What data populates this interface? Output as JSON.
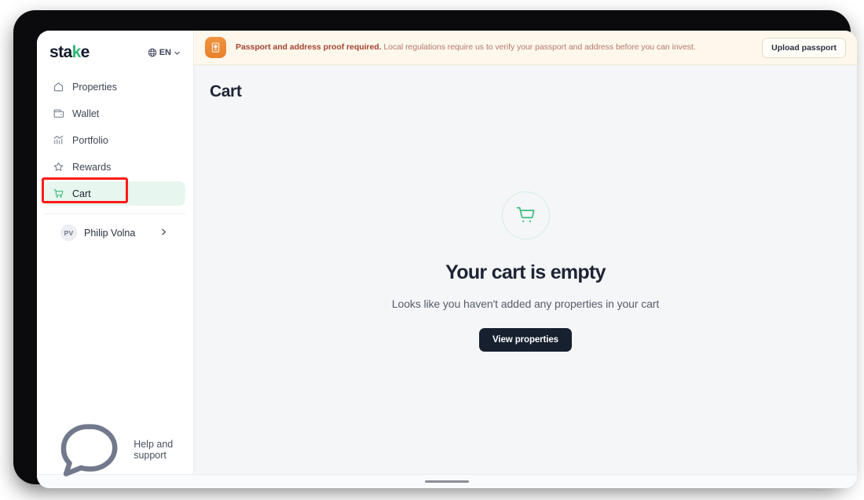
{
  "brand": {
    "logo_main": "sta",
    "logo_accent": "k",
    "logo_tail": "e",
    "accent_color": "#2fb875"
  },
  "sidebar": {
    "language": {
      "label": "EN",
      "icon": "globe-icon",
      "chevron": "chevron-down-icon"
    },
    "items": [
      {
        "label": "Properties",
        "icon": "home-outline-icon",
        "active": false
      },
      {
        "label": "Wallet",
        "icon": "wallet-icon",
        "active": false
      },
      {
        "label": "Portfolio",
        "icon": "bar-chart-icon",
        "active": false
      },
      {
        "label": "Rewards",
        "icon": "star-icon",
        "active": false
      },
      {
        "label": "Cart",
        "icon": "cart-icon",
        "active": true
      }
    ],
    "profile": {
      "initials": "PV",
      "name": "Philip Volna",
      "chevron": "chevron-right-icon"
    },
    "help": {
      "label": "Help and support",
      "icon": "chat-bubble-icon"
    }
  },
  "banner": {
    "icon": "passport-icon",
    "title": "Passport and address proof required.",
    "message": " Local regulations require us to verify your passport and address before you can invest.",
    "button_label": "Upload passport",
    "bg_color": "#fdf7ec",
    "accent_color": "#e9812c"
  },
  "main": {
    "page_title": "Cart",
    "empty_state": {
      "icon": "cart-icon",
      "title": "Your cart is empty",
      "subtitle": "Looks like you haven't added any properties in your cart",
      "button_label": "View properties"
    }
  },
  "device": {
    "home_indicator": "home-indicator-bar"
  }
}
